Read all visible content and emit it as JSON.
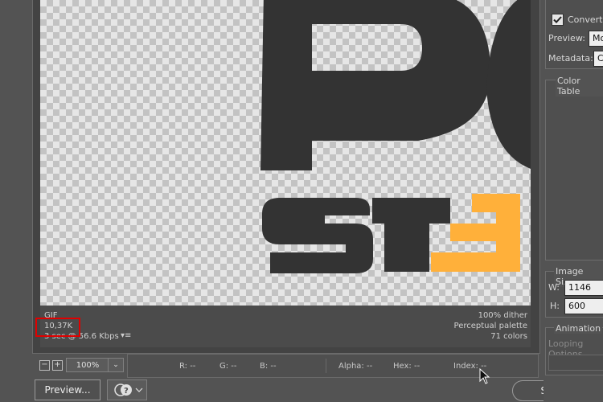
{
  "image": {
    "format": "GIF",
    "file_size": "10,37K",
    "download_time": "3 sec @ 56.6 Kbps",
    "dither": "100% dither",
    "palette": "Perceptual palette",
    "colors": "71 colors",
    "art_letters": [
      "P",
      "C",
      "S",
      "T",
      "E"
    ]
  },
  "toolbar": {
    "zoom_out_symbol": "−",
    "zoom_in_symbol": "+",
    "zoom_value": "100%",
    "preview_label": "Preview...",
    "save_label": "Save...",
    "browser_icon": "browser-help-icon"
  },
  "readout": {
    "r": "R: --",
    "g": "G: --",
    "b": "B: --",
    "alpha": "Alpha: --",
    "hex": "Hex: --",
    "index": "Index: --"
  },
  "panel": {
    "convert_label": "Convert",
    "convert_checked": true,
    "preview_label": "Preview:",
    "preview_value": "Mo",
    "metadata_label": "Metadata:",
    "metadata_value": "C",
    "color_table_label": "Color Table",
    "image_size_label": "Image Size",
    "w_label": "W:",
    "w_value": "1146",
    "h_label": "H:",
    "h_value": "600",
    "animation_label": "Animation",
    "looping_label": "Looping Options"
  },
  "colors": {
    "art_dark": "#333333",
    "art_accent": "#ffb03a",
    "highlight_box": "#e00000"
  }
}
